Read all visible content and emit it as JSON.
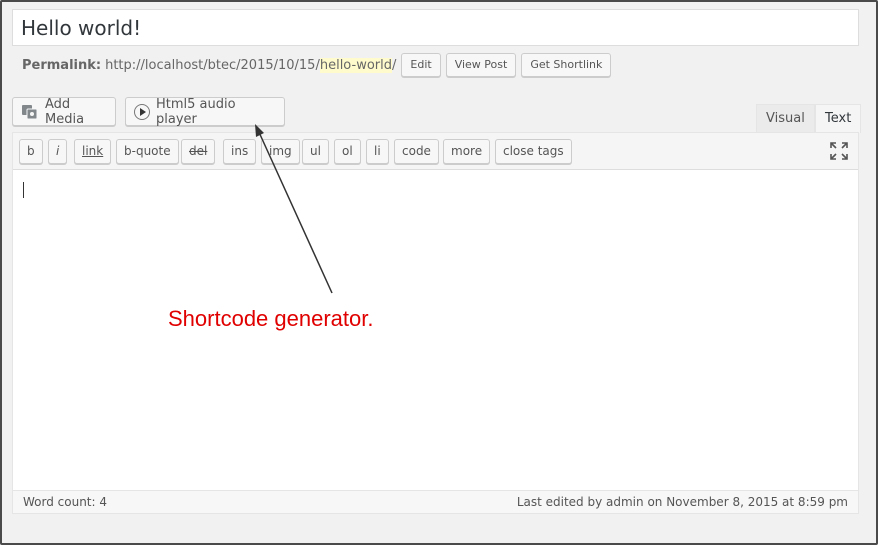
{
  "post": {
    "title": "Hello world!",
    "permalink_label": "Permalink:",
    "permalink_base": "http://localhost/btec/2015/10/15/",
    "permalink_slug": "hello-world",
    "permalink_trail": "/",
    "edit_label": "Edit",
    "view_post_label": "View Post",
    "shortlink_label": "Get Shortlink"
  },
  "media_buttons": {
    "add_media": "Add Media",
    "audio_player": "Html5 audio player"
  },
  "editor_tabs": {
    "visual": "Visual",
    "text": "Text"
  },
  "quicktags": [
    "b",
    "i",
    "link",
    "b-quote",
    "del",
    "ins",
    "img",
    "ul",
    "ol",
    "li",
    "code",
    "more",
    "close tags"
  ],
  "status": {
    "word_count": "Word count: 4",
    "last_edited": "Last edited by admin on November 8, 2015 at 8:59 pm"
  },
  "annotation": {
    "text": "Shortcode generator.",
    "color": "#e00000"
  }
}
